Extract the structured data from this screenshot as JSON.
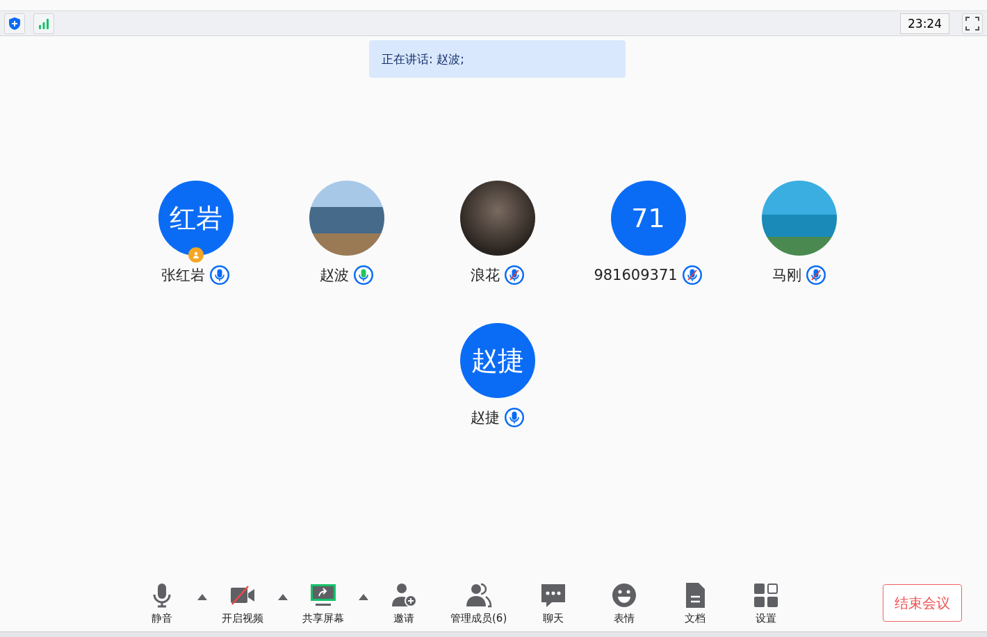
{
  "top_bar": {
    "time": "23:24"
  },
  "speaking_banner": "正在讲话: 赵波;",
  "participants": [
    {
      "name": "张红岩",
      "kind": "initials",
      "initials": "红岩",
      "host": true,
      "muted": false,
      "speaking": false
    },
    {
      "name": "赵波",
      "kind": "photo",
      "host": false,
      "muted": false,
      "speaking": true
    },
    {
      "name": "浪花",
      "kind": "photo",
      "host": false,
      "muted": true,
      "speaking": false
    },
    {
      "name": "981609371",
      "kind": "initials",
      "initials": "71",
      "host": false,
      "muted": true,
      "speaking": false
    },
    {
      "name": "马刚",
      "kind": "photo",
      "host": false,
      "muted": true,
      "speaking": false
    },
    {
      "name": "赵捷",
      "kind": "initials",
      "initials": "赵捷",
      "host": false,
      "muted": false,
      "speaking": false
    }
  ],
  "toolbar": [
    "静音",
    "开启视频",
    "共享屏幕",
    "邀请",
    "管理成员(6)",
    "聊天",
    "表情",
    "文档",
    "设置"
  ],
  "end_button": "结束会议"
}
